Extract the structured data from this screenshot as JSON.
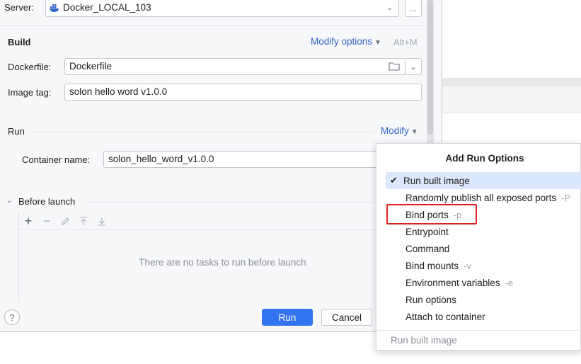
{
  "server": {
    "label": "Server:",
    "value": "Docker_LOCAL_103",
    "more": "..."
  },
  "build": {
    "title": "Build",
    "modify_options": "Modify options",
    "shortcut": "Alt+M",
    "dockerfile_label": "Dockerfile:",
    "dockerfile_value": "Dockerfile",
    "image_tag_label": "Image tag:",
    "image_tag_value": "solon hello word v1.0.0"
  },
  "run": {
    "title": "Run",
    "modify": "Modify",
    "container_name_label": "Container name:",
    "container_name_value": "solon_hello_word_v1.0.0"
  },
  "before_launch": {
    "title": "Before launch",
    "empty_text": "There are no tasks to run before launch"
  },
  "buttons": {
    "help": "?",
    "run": "Run",
    "cancel": "Cancel"
  },
  "popup": {
    "title": "Add Run Options",
    "items": [
      {
        "label": "Run built image",
        "shortcut": "",
        "checked": true
      },
      {
        "label": "Randomly publish all exposed ports",
        "shortcut": "-P",
        "checked": false
      },
      {
        "label": "Bind ports",
        "shortcut": "-p",
        "checked": false
      },
      {
        "label": "Entrypoint",
        "shortcut": "",
        "checked": false
      },
      {
        "label": "Command",
        "shortcut": "",
        "checked": false
      },
      {
        "label": "Bind mounts",
        "shortcut": "-v",
        "checked": false
      },
      {
        "label": "Environment variables",
        "shortcut": "-e",
        "checked": false
      },
      {
        "label": "Run options",
        "shortcut": "",
        "checked": false
      },
      {
        "label": "Attach to container",
        "shortcut": "",
        "checked": false
      }
    ],
    "footer": "Run built image"
  },
  "colors": {
    "accent": "#3574f0",
    "link": "#2f63c4",
    "highlight": "#e02020",
    "selected_row": "#dbe7fd"
  },
  "icons": [
    "docker-icon",
    "chevron-down-icon",
    "folder-icon",
    "add-icon",
    "remove-icon",
    "edit-icon",
    "move-up-icon",
    "move-down-icon",
    "checkmark-icon",
    "help-icon"
  ]
}
